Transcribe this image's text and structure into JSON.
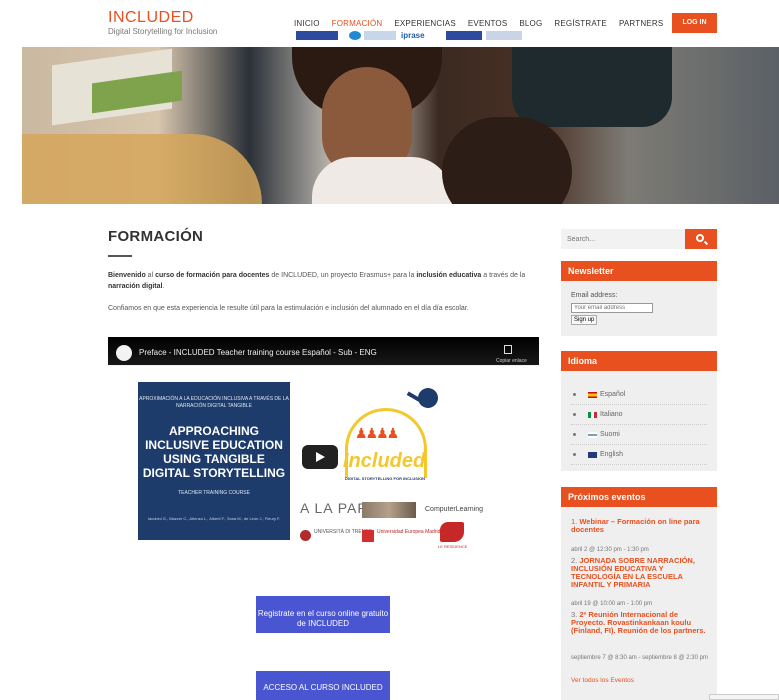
{
  "header": {
    "logo_title": "INCLUDED",
    "logo_subtitle": "Digital Storytelling for Inclusion",
    "nav": [
      {
        "label": "INICIO"
      },
      {
        "label": "FORMACIÓN",
        "active": true
      },
      {
        "label": "EXPERIENCIAS"
      },
      {
        "label": "EVENTOS"
      },
      {
        "label": "BLOG"
      },
      {
        "label": "REGÍSTRATE"
      },
      {
        "label": "PARTNERS"
      }
    ],
    "login_label": "LOG IN"
  },
  "main": {
    "title": "FORMACIÓN",
    "intro": {
      "t1": "Bienvenido",
      "t2": " al ",
      "t3": "curso de formación para docentes",
      "t4": " de INCLUDED, un proyecto Erasmus+ para la ",
      "t5": "inclusión educativa",
      "t6": " a través de la ",
      "t7": "narración digital",
      "t8": "."
    },
    "intro2": "Confiamos en que esta experiencia le resulte útil para la estimulación e inclusión del alumnado en el día día escolar.",
    "video": {
      "title": "Preface - INCLUDED Teacher training course Español - Sub - ENG",
      "copy_label": "Copiar enlace",
      "slide_heading_small": "APROXIMACIÓN A LA EDUCACIÓN INCLUSIVA A TRAVÉS DE LA NARRACIÓN DIGITAL TANGIBLE",
      "slide_heading": "APPROACHING INCLUSIVE EDUCATION USING TANGIBLE DIGITAL STORYTELLING",
      "slide_course": "TEACHER TRAINING COURSE",
      "slide_authors": "Iacobini G., Mazzer C., Atienza L., Alberti F., Sosa M., de León J., Fleury F.",
      "logo_word": "Included",
      "logo_sub": "DIGITAL STORYTELLING FOR INCLUSION",
      "partner_iprase": "iprase",
      "partner_alapar": "A LA PAR",
      "partner_cl": "ComputerLearning",
      "partner_trento": "UNIVERSITÀ DI TRENTO",
      "partner_uem": "Universidad Europea Madrid",
      "partner_gal": "LE RESIDENCE"
    },
    "register_button": "Registrate en el curso online gratuito de INCLUDED",
    "access_button": "ACCESO AL CURSO INCLUDED"
  },
  "sidebar": {
    "search_placeholder": "Search...",
    "newsletter": {
      "title": "Newsletter",
      "email_label": "Email address:",
      "email_placeholder": "Your email address",
      "signup_label": "Sign up"
    },
    "language": {
      "title": "Idioma",
      "items": [
        {
          "label": "Español",
          "flag": "es"
        },
        {
          "label": "Italiano",
          "flag": "it"
        },
        {
          "label": "Suomi",
          "flag": "fi"
        },
        {
          "label": "English",
          "flag": "en"
        }
      ]
    },
    "events": {
      "title": "Próximos eventos",
      "items": [
        {
          "num": "1.",
          "title": "Webinar – Formación on line para docentes",
          "date": "abril 2 @ 12:30 pm - 1:30 pm"
        },
        {
          "num": "2.",
          "title": "JORNADA SOBRE NARRACIÓN, INCLUSIÓN EDUCATIVA Y TECNOLOGÍA EN LA ESCUELA INFANTIL Y PRIMARIA",
          "date": "abril 19 @ 10:00 am - 1:00 pm"
        },
        {
          "num": "3.",
          "title": "2ª Reunión Internacional de Proyecto. Rovastinkankaan koulu (Finland, FI). Reunión de los partners.",
          "date": "septiembre 7 @ 8:30 am - septiembre 8 @ 2:30 pm"
        }
      ],
      "view_all": "Ver todos los Eventos"
    }
  },
  "colors": {
    "accent": "#e8501f",
    "button_blue": "#4a55d1",
    "slide_navy": "#1e3c6b"
  }
}
